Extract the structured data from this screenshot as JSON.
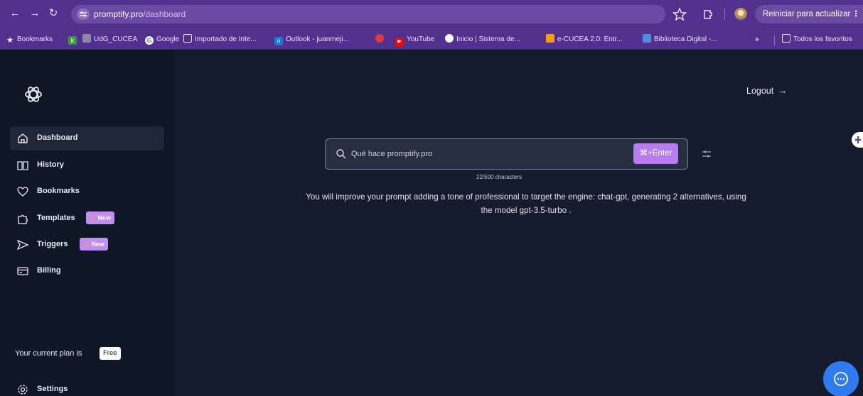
{
  "browser": {
    "url_host": "promptify.pro",
    "url_path": "/dashboard",
    "update_button": "Reiniciar para actualizar",
    "bookmarks": [
      {
        "label": "Bookmarks",
        "icon": "star-icon"
      },
      {
        "label": "",
        "icon": "k-favicon"
      },
      {
        "label": "UdG_CUCEA",
        "icon": "udg-favicon"
      },
      {
        "label": "Google",
        "icon": "google-icon"
      },
      {
        "label": "Importado de Inte...",
        "icon": "folder-icon"
      },
      {
        "label": "Outlook - juanmeji...",
        "icon": "outlook-icon"
      },
      {
        "label": "",
        "icon": "red-dot-icon"
      },
      {
        "label": "YouTube",
        "icon": "youtube-icon"
      },
      {
        "label": "Inicio | Sistema de...",
        "icon": "globe-icon"
      },
      {
        "label": "e-CUCEA 2.0: Entr...",
        "icon": "ecucea-icon"
      },
      {
        "label": "Biblioteca Digital -...",
        "icon": "library-icon"
      }
    ],
    "more_bookmarks": "»",
    "all_favorites": "Todos los favoritos"
  },
  "sidebar": {
    "items": [
      {
        "label": "Dashboard",
        "icon": "home-icon",
        "active": true
      },
      {
        "label": "History",
        "icon": "book-icon",
        "active": false
      },
      {
        "label": "Bookmarks",
        "icon": "heart-icon",
        "active": false
      },
      {
        "label": "Templates",
        "icon": "puzzle-icon",
        "active": false,
        "badge": "New"
      },
      {
        "label": "Triggers",
        "icon": "send-icon",
        "active": false,
        "badge": "New"
      },
      {
        "label": "Billing",
        "icon": "credit-card-icon",
        "active": false
      }
    ],
    "plan_label": "Your current plan is",
    "plan_value": "Free",
    "settings_label": "Settings"
  },
  "header": {
    "logout_label": "Logout",
    "logout_arrow": "→"
  },
  "search": {
    "value": "Qué hace promptify.pro",
    "submit_label": "⌘+Enter",
    "char_count": "22/500 characters"
  },
  "summary": {
    "line1": "You will improve your prompt adding a tone of professional to target the engine: chat-gpt, generating 2 alternatives, using",
    "line2": "the model gpt-3.5-turbo ."
  },
  "colors": {
    "browser_chrome": "#52308d",
    "sidebar_bg": "#0f1626",
    "main_bg": "#141b2d",
    "accent": "#b67cf0",
    "chat_button": "#2f7bf0"
  }
}
